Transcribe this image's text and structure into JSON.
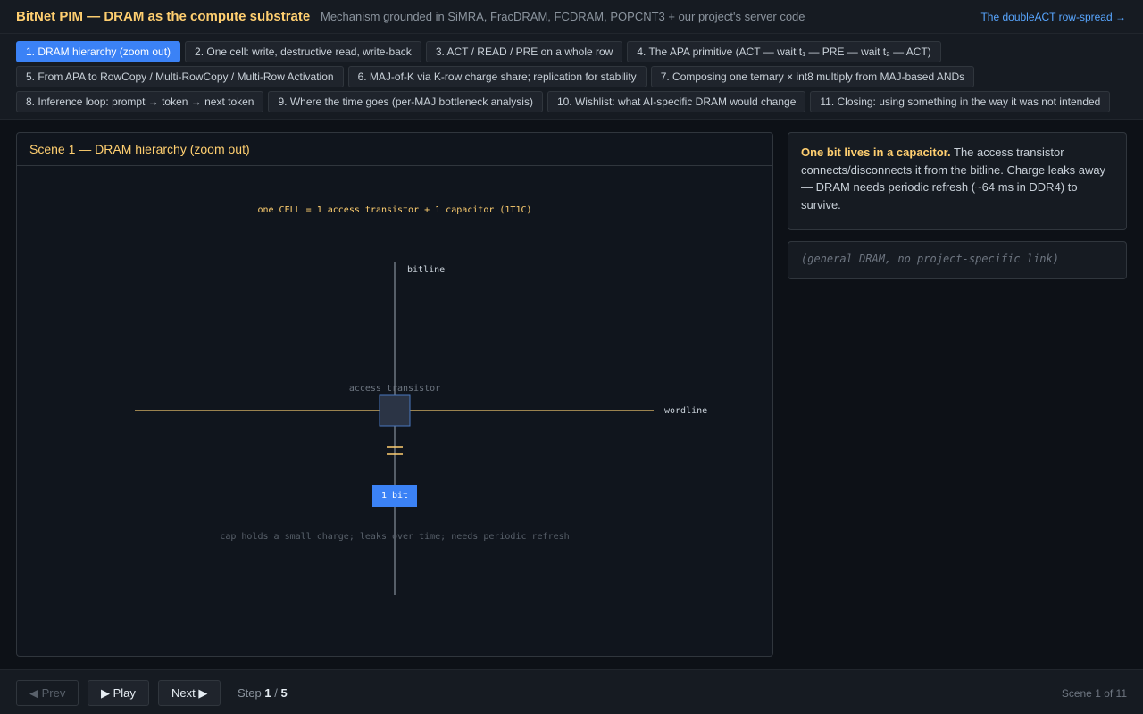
{
  "header": {
    "title": "BitNet PIM — DRAM as the compute substrate",
    "subtitle": "Mechanism grounded in SiMRA, FracDRAM, FCDRAM, POPCNT3 + our project's server code",
    "link": "The doubleACT row-spread →"
  },
  "tabs": [
    {
      "label": "1. DRAM hierarchy (zoom out)",
      "active": true
    },
    {
      "label": "2. One cell: write, destructive read, write-back"
    },
    {
      "label": "3. ACT / READ / PRE on a whole row"
    },
    {
      "label": "4. The APA primitive (ACT — wait t₁ — PRE — wait t₂ — ACT)"
    },
    {
      "label": "5. From APA to RowCopy / Multi-RowCopy / Multi-Row Activation"
    },
    {
      "label": "6. MAJ-of-K via K-row charge share; replication for stability"
    },
    {
      "label": "7. Composing one ternary × int8 multiply from MAJ-based ANDs"
    },
    {
      "label": "8. Inference loop: prompt → token → next token"
    },
    {
      "label": "9. Where the time goes (per-MAJ bottleneck analysis)"
    },
    {
      "label": "10. Wishlist: what AI-specific DRAM would change"
    },
    {
      "label": "11. Closing: using something in the way it was not intended"
    }
  ],
  "scene": {
    "title": "Scene 1 — DRAM hierarchy (zoom out)",
    "diagram": {
      "caption": "one CELL = 1 access transistor + 1 capacitor (1T1C)",
      "bitline_label": "bitline",
      "wordline_label": "wordline",
      "transistor_label": "access transistor",
      "bit_label": "1 bit",
      "note": "cap holds a small charge; leaks over time; needs periodic refresh"
    }
  },
  "explain": {
    "lead": "One bit lives in a capacitor.",
    "body": " The access transistor connects/disconnects it from the bitline. Charge leaks away — DRAM needs periodic refresh (~64 ms in DDR4) to survive."
  },
  "reference": "(general DRAM, no project-specific link)",
  "footer": {
    "prev": "◀ Prev",
    "play": "▶ Play",
    "next": "Next ▶",
    "step_label": "Step",
    "step_current": "1",
    "step_sep": "/",
    "step_total": "5",
    "scene_count": "Scene 1 of 11"
  },
  "colors": {
    "accent": "#3b82f6",
    "highlight": "#ffcf70",
    "link": "#58a6ff",
    "wordline": "#c9a860"
  }
}
